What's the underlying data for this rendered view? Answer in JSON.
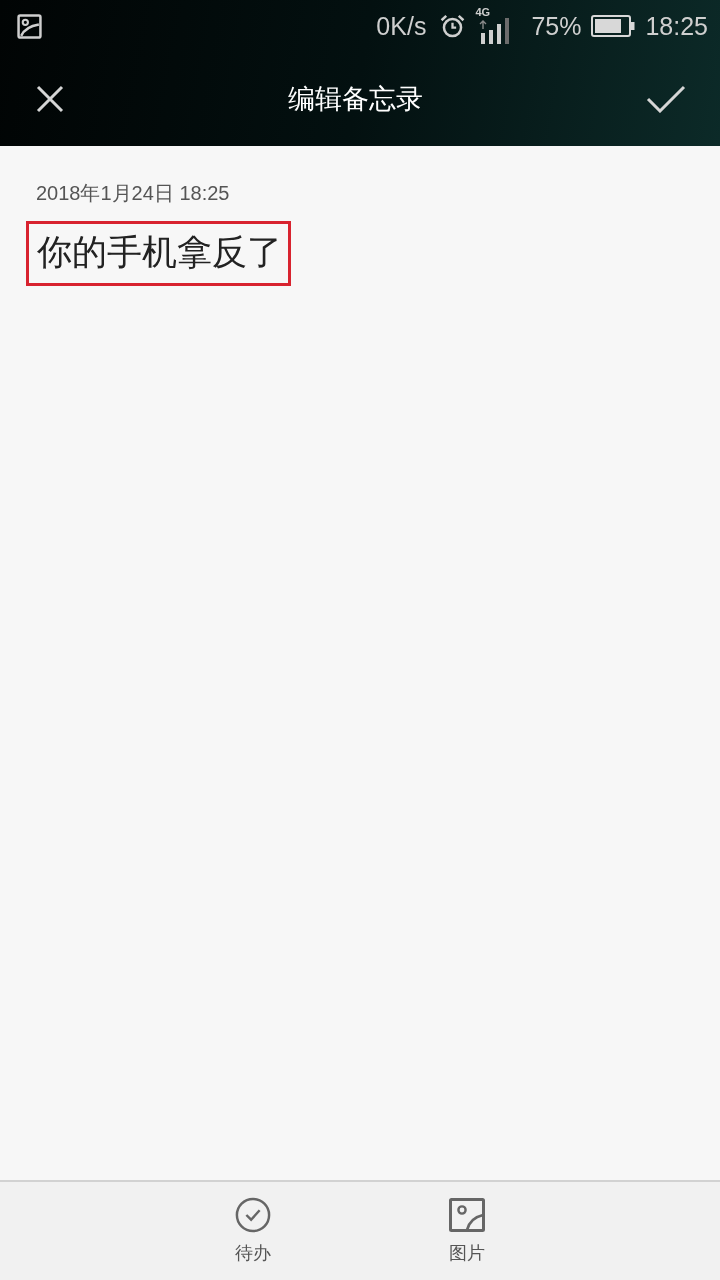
{
  "status_bar": {
    "speed": "0K/s",
    "network": "4G",
    "battery": "75%",
    "time": "18:25"
  },
  "header": {
    "title": "编辑备忘录"
  },
  "note": {
    "date": "2018年1月24日 18:25",
    "text": "你的手机拿反了",
    "highlighted": true
  },
  "toolbar": [
    {
      "label": "待办",
      "kind": "todo"
    },
    {
      "label": "图片",
      "kind": "image"
    }
  ]
}
